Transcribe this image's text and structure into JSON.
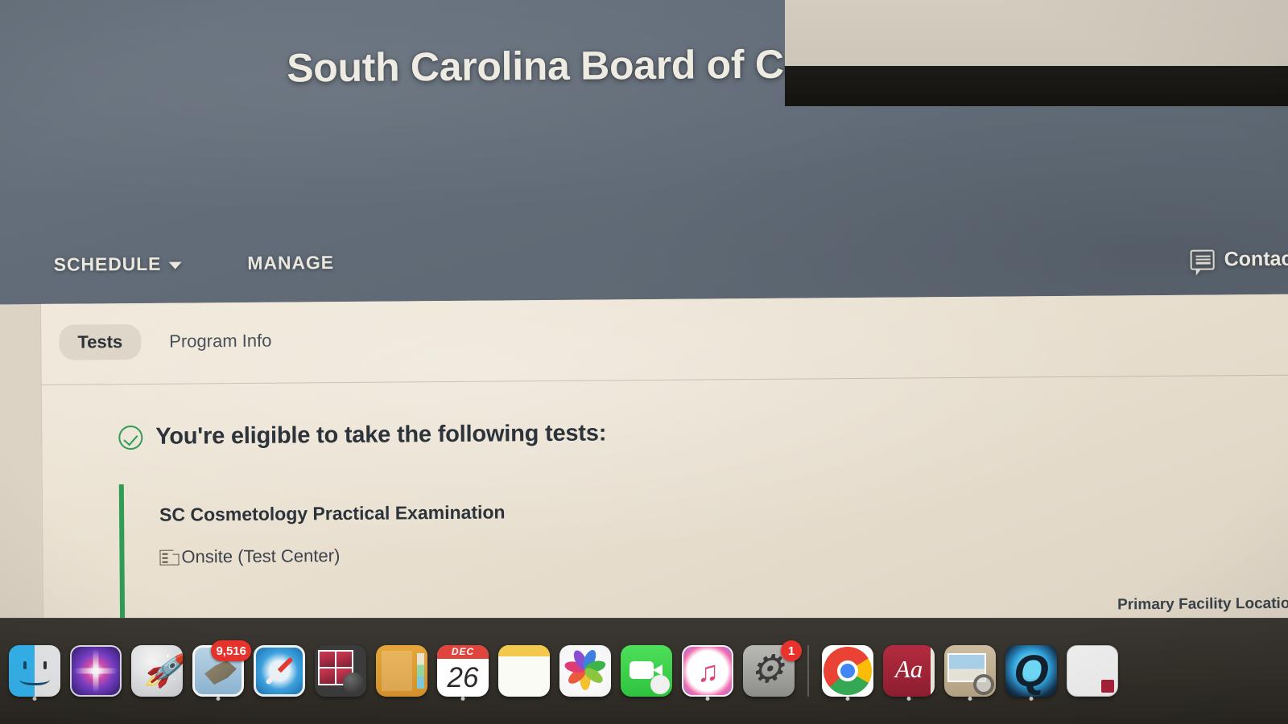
{
  "header": {
    "org_title": "South Carolina Board of Cosmetology",
    "nav": [
      {
        "label": "SCHEDULE",
        "has_caret": true
      },
      {
        "label": "MANAGE",
        "has_caret": false
      }
    ],
    "contact": {
      "label": "Contact Us",
      "icon": "speech-bubble-icon"
    }
  },
  "tabs": [
    {
      "label": "Tests",
      "active": true
    },
    {
      "label": "Program Info",
      "active": false
    }
  ],
  "main": {
    "eligibility_heading": "You're eligible to take the following tests:",
    "eligibility_icon": "check-circle-icon",
    "test": {
      "title": "SC Cosmetology Practical Examination",
      "delivery_mode": "Onsite (Test Center)",
      "delivery_icon": "building-icon"
    },
    "facility_label": "Primary Facility Location"
  },
  "cursor": {
    "type": "pointing-hand-cursor"
  },
  "colors": {
    "header_bg": "#626c78",
    "page_bg": "#e9e0d0",
    "accent_green": "#2f9d55",
    "text_dark": "#2c333b",
    "badge_red": "#e8332c"
  },
  "dock": {
    "items": [
      {
        "name": "finder",
        "label": "Finder",
        "running": true
      },
      {
        "name": "siri",
        "label": "Siri",
        "running": false
      },
      {
        "name": "launchpad",
        "label": "Launchpad",
        "running": false
      },
      {
        "name": "mail",
        "label": "Mail",
        "running": true,
        "badge": "9,516"
      },
      {
        "name": "safari",
        "label": "Safari",
        "running": false
      },
      {
        "name": "photobooth",
        "label": "Photo Booth",
        "running": false
      },
      {
        "name": "contacts",
        "label": "Contacts",
        "running": false
      },
      {
        "name": "calendar",
        "label": "Calendar",
        "running": true,
        "month": "DEC",
        "day": "26"
      },
      {
        "name": "notes",
        "label": "Notes",
        "running": false
      },
      {
        "name": "photos",
        "label": "Photos",
        "running": false
      },
      {
        "name": "facetime",
        "label": "FaceTime",
        "running": false
      },
      {
        "name": "itunes",
        "label": "iTunes",
        "running": true
      },
      {
        "name": "sysprefs",
        "label": "System Preferences",
        "running": false,
        "badge": "1"
      },
      {
        "name": "chrome",
        "label": "Google Chrome",
        "running": true
      },
      {
        "name": "dictionary",
        "label": "Dictionary",
        "running": true
      },
      {
        "name": "preview",
        "label": "Preview",
        "running": true
      },
      {
        "name": "quicktime",
        "label": "QuickTime Player",
        "running": true
      },
      {
        "name": "window",
        "label": "Minimized Window",
        "running": false
      }
    ]
  }
}
